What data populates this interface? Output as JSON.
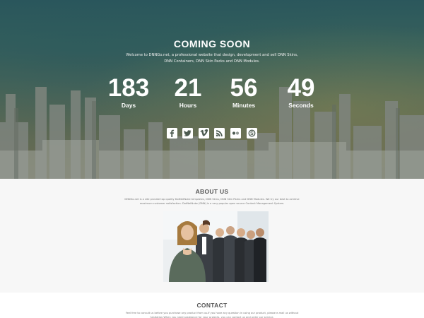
{
  "hero": {
    "title": "COMING SOON",
    "subtitle": "Welcome to DNNGo.net, a professional website that design, development and sell DNN Skins, DNN Containers, DNN Skin Packs and DNN Modules.",
    "countdown": [
      {
        "value": "183",
        "unit": "Days"
      },
      {
        "value": "21",
        "unit": "Hours"
      },
      {
        "value": "56",
        "unit": "Minutes"
      },
      {
        "value": "49",
        "unit": "Seconds"
      }
    ],
    "socials": [
      {
        "icon": "facebook-icon",
        "glyph": "f"
      },
      {
        "icon": "twitter-icon",
        "glyph": "t"
      },
      {
        "icon": "vimeo-icon",
        "glyph": "v"
      },
      {
        "icon": "rss-icon",
        "glyph": "rss"
      },
      {
        "icon": "flickr-icon",
        "glyph": "flickr"
      },
      {
        "icon": "skype-icon",
        "glyph": "S"
      }
    ]
  },
  "about": {
    "title": "ABOUT US",
    "text": "DNNGo.net is a site provide top quality DotNetNuke templates, DNN Skins, DNN Skin Packs and DNN Modules. We try our best to achieve maximum customer satisfaction. DotNetNuke (DNN) is a very popular open source Content Management System."
  },
  "contact": {
    "title": "CONTACT",
    "text": "Feel free to consult us before you purchase any product from us.If you have any question in using our product, please e-mail us without hesitation.When you need assistance for your projects, you can contact us and order our service."
  },
  "colors": {
    "hero_overlay": "#3f6a62",
    "about_bg": "#f7f7f7",
    "heading": "#555555"
  }
}
